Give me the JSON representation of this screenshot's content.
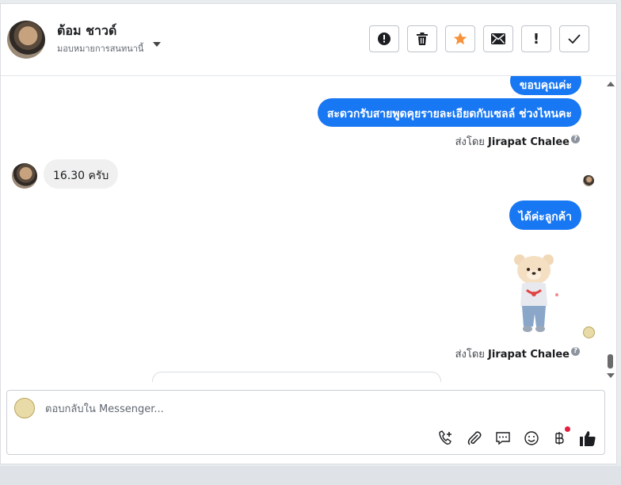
{
  "header": {
    "contact_name": "ต้อม ชาวด์",
    "assign_label": "มอบหมายการสนทนานี้",
    "toolbar": [
      {
        "name": "spam-button",
        "icon": "alert-circle-icon"
      },
      {
        "name": "delete-button",
        "icon": "trash-icon"
      },
      {
        "name": "star-button",
        "icon": "star-icon"
      },
      {
        "name": "mark-unread-button",
        "icon": "envelope-icon"
      },
      {
        "name": "follow-up-button",
        "icon": "exclamation-icon",
        "label": "!"
      },
      {
        "name": "done-button",
        "icon": "checkmark-icon"
      }
    ]
  },
  "messages": {
    "m1": "ขอบคุณค่ะ",
    "m2": "สะดวกรับสายพูดคุยรายละเอียดกับเซลล์ ช่วงไหนคะ",
    "m3": "16.30 ครับ",
    "m4": "ได้ค่ะลูกค้า",
    "sent_by_prefix": "ส่งโดย",
    "sent_by_name": "Jirapat Chalee",
    "help_icon": "?"
  },
  "composer": {
    "placeholder": "ตอบกลับใน Messenger..."
  },
  "colors": {
    "accent": "#1877f2",
    "star": "#f7923a",
    "notification": "#e41e3f"
  }
}
